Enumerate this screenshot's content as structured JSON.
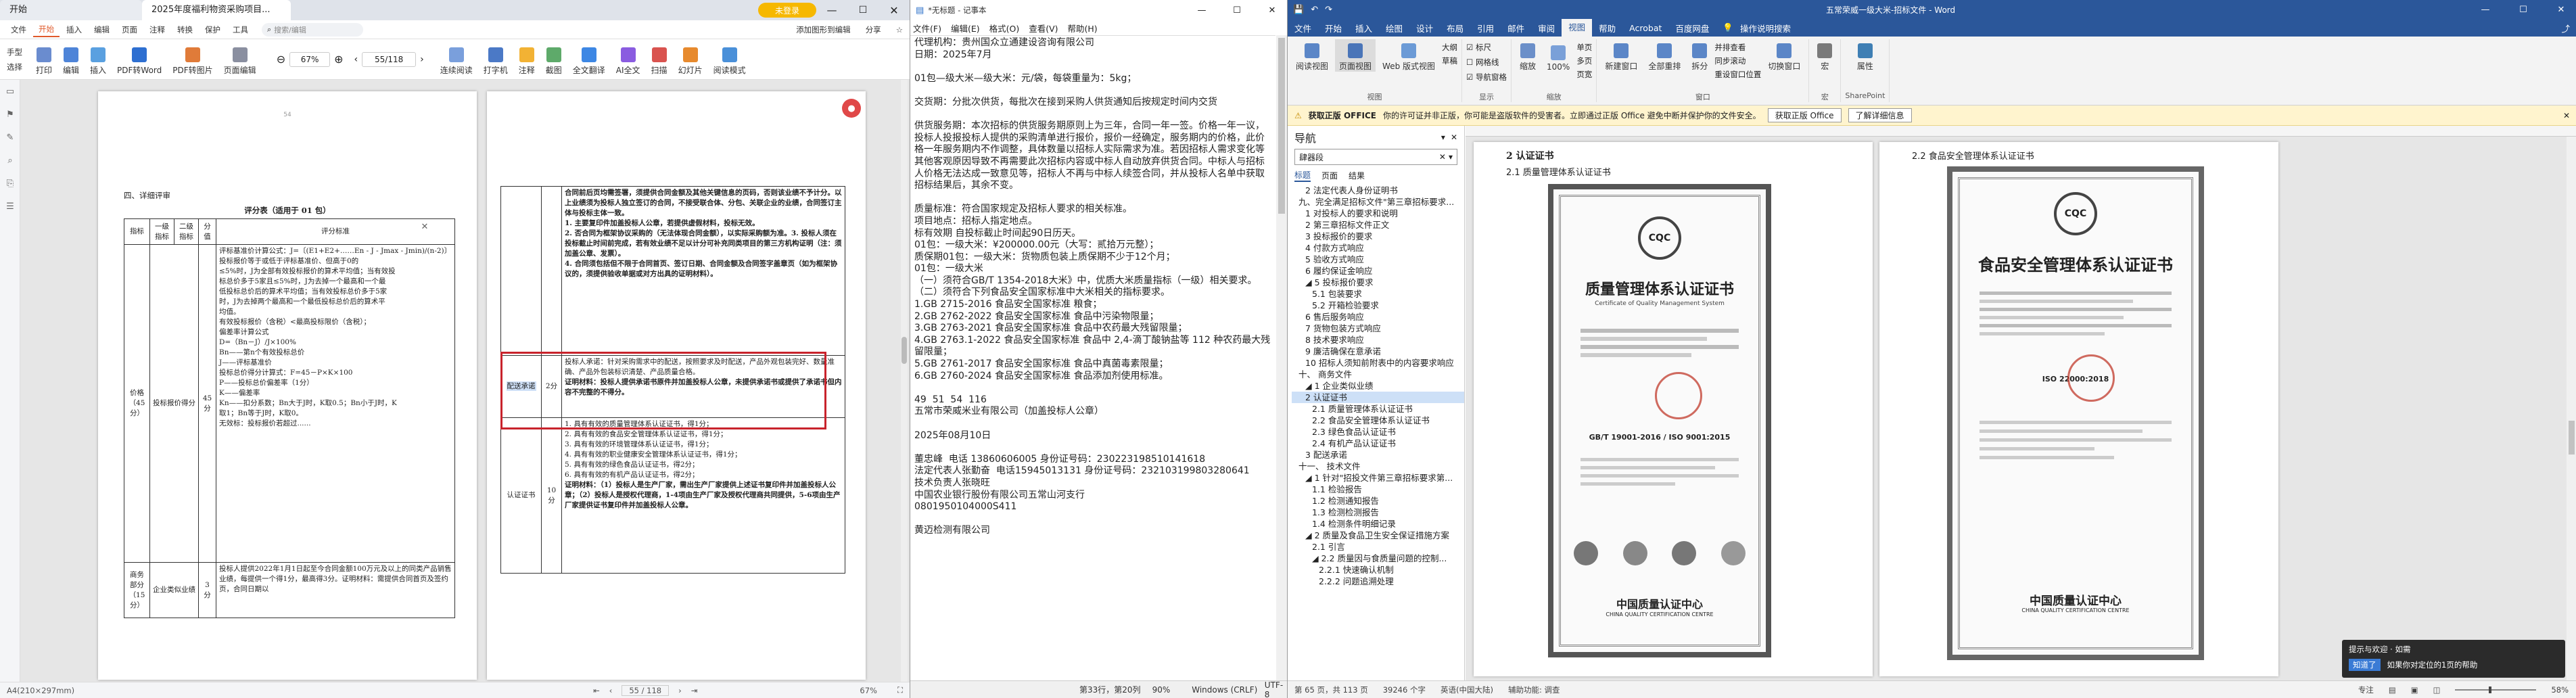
{
  "pdf": {
    "tabs": [
      {
        "label": "开始",
        "active": false
      },
      {
        "label": "2025年度福利物资采购项目...",
        "active": true
      }
    ],
    "tab_right": "未登录",
    "menu": [
      "文件",
      "开始",
      "插入",
      "编辑",
      "页面",
      "注释",
      "转换",
      "保护",
      "工具"
    ],
    "menu_active": "开始",
    "search_placeholder": "搜索/编辑",
    "menu_right": [
      "添加图形到编辑",
      "分享",
      "☆"
    ],
    "toolbar_left": [
      "手型",
      "选择"
    ],
    "toolbar": [
      "打印",
      "编辑",
      "插入",
      "PDF转Word",
      "PDF转图片",
      "页面编辑"
    ],
    "zoom": "67%",
    "page_input": "55/118",
    "toolbar_right": [
      "连续阅读",
      "打字机",
      "注释",
      "截图",
      "全文翻译",
      "AI全文",
      "扫描",
      "幻灯片",
      "阅读模式"
    ],
    "left_page_top": "54",
    "left_page": {
      "section": "四、详细评审",
      "title": "评分表（适用于 01 包）",
      "headers": [
        "指标",
        "一级指标",
        "二级指标",
        "分值",
        "评分标准"
      ],
      "price_group": "价格（45分）",
      "price_sub": "投标报价得分",
      "price_score": "45分",
      "price_text": [
        "评标基准价计算公式：J=〔(E1+E2+……En - J - Jmax - Jmin)/(n-2)〕",
        "投标报价等于或低于评标基准价、但高于0的",
        "≤5%时，J为全部有效投标报价的算术平均值；当有效投",
        "标总价多于5家且≤5%时，J为去掉一个最高和一个最",
        "低投标总价后的算术平均值；当有效投标总价多于5家",
        "时，J为去掉两个最高和一个最低投标总价后的算术平",
        "均值。",
        "有效投标报价（含税）<最高投标限价（含税）；",
        "偏差率计算公式",
        "D=（Bn－J）/J×100%",
        "Bn——第n个有效投标总价",
        "J——评标基准价",
        "投标总价得分计算式：F=45－P×K×100",
        "P——投标总价偏差率（1分）",
        "K——偏差率",
        "Kn——扣分系数；Bn大于J时，K取0.5；Bn小于J时，K",
        "取1；Bn等于J时，K取0。",
        "无效标：投标报价若超过......"
      ],
      "biz_group": "商务部分（15分）",
      "biz_sub": "企业类似业绩",
      "biz_score": "3分",
      "biz_text": "投标人提供2022年1月1日起至今合同金额100万元及以上的同类产品销售业绩，每提供一个得1分，最高得3分。证明材料：需提供合同首页及签约页，合同日期以"
    },
    "right_page_top": "",
    "right_page": {
      "r1": "合同前后页均需签署，须提供合同金额及其他关键信息的页码，否则该业绩不予计分。以上业绩须为投标人独立签订的合同，不接受联合体、分包、关联企业的业绩，合同签订主体与投标主体一致。",
      "r1b": "1. 主要复印件加盖投标人公章，若提供虚假材料，投标无效。",
      "r1c": "2. 否合同为框架协议采购的（无法体现合同金额），以实际采购额为准。3. 投标人须在投标截止时间前完成，若有效业绩不足以计分可补充同类项目的第三方机构证明（注：须加盖公章、发票）。",
      "r1d": "4. 合同须包括但不限于合同首页、签订日期、合同金额及合同签字盖章页（如为框架协议的，须提供验收单据或对方出具的证明材料）。",
      "hl_label": "配送承诺",
      "hl_score": "2分",
      "hl_text": "投标人承诺：针对采购需求中的配送，按照要求及时配送，产品外观包装完好、数量准确、产品外包装标识清楚、产品质量合格。",
      "hl_bold": "证明材料：投标人提供承诺书原件并加盖投标人公章，未提供承诺书或提供了承诺书但内容不完整的不得分。",
      "cert_label": "认证证书",
      "cert_score": "10分",
      "cert_lines": [
        "1. 具有有效的质量管理体系认证证书，得1分；",
        "2. 具有有效的食品安全管理体系认证证书，得1分；",
        "3. 具有有效的环境管理体系认证证书，得1分；",
        "4. 具有有效的职业健康安全管理体系认证证书，得1分；",
        "5. 具有有效的绿色食品认证证书，得2分；",
        "6. 具有有效的有机产品认证证书，得2分；"
      ],
      "cert_bold": "证明材料：（1）投标人是生产厂家，需出生产厂家提供上述证书复印件并加盖投标人公章；（2）投标人是授权代理商，1-4项由生产厂家及授权代理商共同提供，5-6项由生产厂家提供证书复印件并加盖投标人公章。"
    },
    "status_left": "A4(210×297mm)",
    "status_page": "55 / 118",
    "status_zoom": "67%"
  },
  "notepad": {
    "title": "*无标题 - 记事本",
    "menu": [
      "文件(F)",
      "编辑(E)",
      "格式(O)",
      "查看(V)",
      "帮助(H)"
    ],
    "lines": [
      "代理机构：贵州国众立通建设咨询有限公司",
      "日期：2025年7月",
      "",
      "01包—级大米—级大米：元/袋，每袋重量为：5kg；",
      "",
      "交货期：分批次供货，每批次在接到采购人供货通知后按规定时间内交货",
      "",
      "供货服务期：本次招标的供货服务期原则上为三年，合同一年一签。价格一年一议，投标人投报投标人提供的采购清单进行报价，报价一经确定，服务期内的价格，此价格一年服务期内不作调整，具体数量以招标人实际需求为准。若因招标人需求变化等其他客观原因导致不再需要此次招标内容或中标人自动放弃供货合同。中标人与招标人价格无法达成一致意见等，招标人不再与中标人续签合同，并从投标人名单中获取招标结果后，其余不变。",
      "",
      "质量标准：符合国家规定及招标人要求的相关标准。",
      "项目地点：招标人指定地点。",
      "标有效期 自投标截止时间起90日历天。",
      "01包：一级大米：¥200000.00元（大写：贰拾万元整）；",
      "质保期01包：一级大米：货物质包装上质保期不少于12个月；",
      "01包：一级大米",
      "（一）须符合GB/T 1354-2018大米》中，优质大米质量指标（一级）相关要求。",
      "（二）须符合下列食品安全国家标准中大米相关的指标要求。",
      "1.GB 2715-2016 食品安全国家标准 粮食；",
      "2.GB 2762-2022 食品安全国家标准 食品中污染物限量；",
      "3.GB 2763-2021 食品安全国家标准 食品中农药最大残留限量；",
      "4.GB 2763.1-2022 食品安全国家标准 食品中 2,4-滴丁酸钠盐等 112 种农药最大残留限量；",
      "5.GB 2761-2017 食品安全国家标准 食品中真菌毒素限量；",
      "6.GB 2760-2024 食品安全国家标准 食品添加剂使用标准。",
      "",
      "49  51  54  116",
      "五常市荣威米业有限公司（加盖投标人公章）",
      "",
      "2025年08月10日",
      "",
      "董忠峰  电话 13860606005 身份证号码：230223198510141618",
      "法定代表人张勤奋  电话15945013131 身份证号码：232103199803280641",
      "技术负责人张晓旺",
      "中国农业银行股份有限公司五常山河支行",
      "0801950104000S411",
      "",
      "黄迈检测有限公司"
    ],
    "status": [
      "第33行，第20列",
      "90%",
      "Windows (CRLF)",
      "UTF-8"
    ]
  },
  "word": {
    "title": "五常荣威一级大米-招标文件 - Word",
    "qat": [
      "保存",
      "撤销",
      "重做"
    ],
    "tabs": [
      "文件",
      "开始",
      "插入",
      "绘图",
      "设计",
      "布局",
      "引用",
      "邮件",
      "审阅",
      "视图",
      "帮助",
      "Acrobat",
      "百度网盘"
    ],
    "tab_active": "视图",
    "tell_me": "操作说明搜索",
    "ribbon": [
      {
        "group": "视图",
        "items": [
          "阅读视图",
          "页面视图",
          "Web 版式视图"
        ],
        "sub": [
          "大纲",
          "草稿"
        ]
      },
      {
        "group": "显示",
        "items": [],
        "checks": [
          "标尺",
          "网格线",
          "导航窗格"
        ]
      },
      {
        "group": "缩放",
        "items": [
          "缩放",
          "100%"
        ],
        "sub": [
          "单页",
          "多页",
          "页宽"
        ]
      },
      {
        "group": "窗口",
        "items": [
          "新建窗口",
          "全部重排",
          "拆分"
        ],
        "sub": [
          "并排查看",
          "同步滚动",
          "重设窗口位置"
        ]
      },
      {
        "group": "",
        "items": [
          "切换窗口"
        ]
      },
      {
        "group": "宏",
        "items": [
          "宏"
        ]
      },
      {
        "group": "SharePoint",
        "items": [
          "属性"
        ]
      }
    ],
    "infobar_title": "获取正版 OFFICE",
    "infobar_text": "你的许可证并非正版，你可能是盗版软件的受害者。立即通过正版 Office 避免中断并保护你的文件安全。",
    "infobar_btns": [
      "获取正版 Office",
      "了解详细信息"
    ],
    "nav": {
      "title": "导航",
      "search": "肆器段",
      "tabs": [
        "标题",
        "页面",
        "结果"
      ],
      "items": [
        {
          "t": "2 法定代表人身份证明书",
          "l": 2
        },
        {
          "t": "九、完全满足招标文件\"第三章招标要求...",
          "l": 1
        },
        {
          "t": "1 对投标人的要求和说明",
          "l": 2
        },
        {
          "t": "2 第三章招标文件正文",
          "l": 2
        },
        {
          "t": "3 投标报价的要求",
          "l": 2
        },
        {
          "t": "4 付款方式响应",
          "l": 2
        },
        {
          "t": "5 验收方式响应",
          "l": 2
        },
        {
          "t": "6 履约保证金响应",
          "l": 2
        },
        {
          "t": "◢ 5 投标报价要求",
          "l": 2
        },
        {
          "t": "5.1 包装要求",
          "l": 3
        },
        {
          "t": "5.2 开箱检验要求",
          "l": 3
        },
        {
          "t": "6 售后服务响应",
          "l": 2
        },
        {
          "t": "7 货物包装方式响应",
          "l": 2
        },
        {
          "t": "8 技术要求响应",
          "l": 2
        },
        {
          "t": "9 廉洁确保在意承诺",
          "l": 2
        },
        {
          "t": "10 招标人须知前附表中的内容要求响应",
          "l": 2
        },
        {
          "t": "十、 商务文件",
          "l": 1
        },
        {
          "t": "◢ 1 企业类似业绩",
          "l": 2
        },
        {
          "t": "2 认证证书",
          "l": 2,
          "sel": true
        },
        {
          "t": "2.1 质量管理体系认证证书",
          "l": 3
        },
        {
          "t": "2.2 食品安全管理体系认证证书",
          "l": 3
        },
        {
          "t": "2.3 绿色食品认证证书",
          "l": 3
        },
        {
          "t": "2.4 有机产品认证证书",
          "l": 3
        },
        {
          "t": "3 配送承诺",
          "l": 2
        },
        {
          "t": "十一、 技术文件",
          "l": 1
        },
        {
          "t": "◢ 1 针对\"招投文件第三章招标要求第...",
          "l": 2
        },
        {
          "t": "1.1 检验报告",
          "l": 3
        },
        {
          "t": "1.2 检测通知报告",
          "l": 3
        },
        {
          "t": "1.3 检测检测报告",
          "l": 3
        },
        {
          "t": "1.4 检测条件明细记录",
          "l": 3
        },
        {
          "t": "◢ 2 质量及食品卫生安全保证措施方案",
          "l": 2
        },
        {
          "t": "2.1 引言",
          "l": 3
        },
        {
          "t": "◢ 2.2 质量因与食质量问题的控制...",
          "l": 3
        },
        {
          "t": "2.2.1 快速确认机制",
          "l": 4
        },
        {
          "t": "2.2.2 问题追溯处理",
          "l": 4
        }
      ]
    },
    "page1": {
      "h1": "2 认证证书",
      "h2": "2.1 质量管理体系认证证书",
      "cert_title": "质量管理体系认证证书",
      "cert_sub": "Certificate of Quality Management System",
      "std": "GB/T 19001-2016 / ISO 9001:2015",
      "org": "中国质量认证中心",
      "org_en": "CHINA QUALITY CERTIFICATION CENTRE",
      "badge": "CQC"
    },
    "page2": {
      "h2": "2.2 食品安全管理体系认证证书",
      "cert_title": "食品安全管理体系认证证书",
      "std": "ISO 22000:2018",
      "org": "中国质量认证中心",
      "org_en": "CHINA QUALITY CERTIFICATION CENTRE",
      "badge": "CQC"
    },
    "status": [
      "第 65 页，共 113 页",
      "39246 个字",
      "英语(中国大陆)",
      "辅助功能: 调查"
    ],
    "status_right": "专注",
    "zoom": "58%",
    "toast_title": "提示与欢迎 · 如需",
    "toast_text": "如果你对定位的1页的帮助",
    "toast_btn": "知道了"
  }
}
